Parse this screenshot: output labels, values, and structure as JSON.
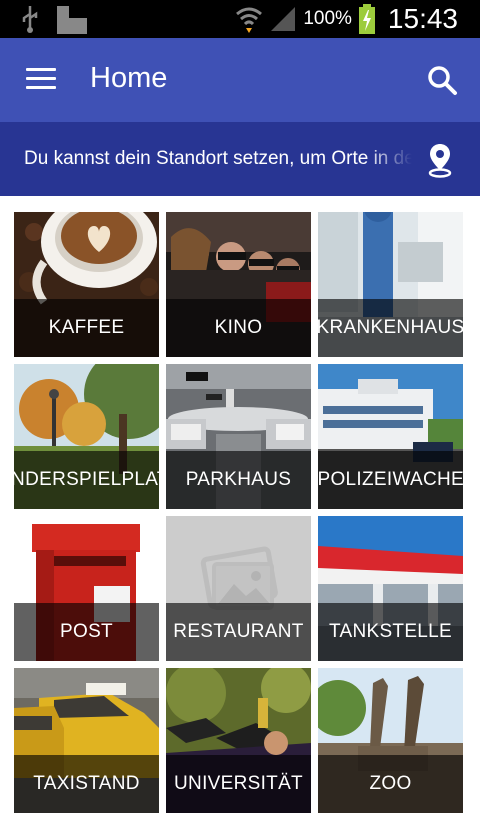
{
  "status_bar": {
    "battery": "100%",
    "time": "15:43"
  },
  "app_bar": {
    "title": "Home",
    "menu_icon": "hamburger-menu-icon",
    "search_icon": "search-icon",
    "color": "#3f51b5"
  },
  "banner": {
    "text": "Du kannst dein Standort setzen, um Orte in der Nähe zu finden",
    "icon": "location-pin-icon",
    "color": "#283593"
  },
  "categories": [
    {
      "label": "KAFFEE"
    },
    {
      "label": "KINO"
    },
    {
      "label": "KRANKENHAUS"
    },
    {
      "label": "KINDERSPIELPLATZ"
    },
    {
      "label": "PARKHAUS"
    },
    {
      "label": "POLIZEIWACHE"
    },
    {
      "label": "POST"
    },
    {
      "label": "RESTAURANT"
    },
    {
      "label": "TANKSTELLE"
    },
    {
      "label": "TAXISTAND"
    },
    {
      "label": "UNIVERSITÄT"
    },
    {
      "label": "ZOO"
    }
  ]
}
